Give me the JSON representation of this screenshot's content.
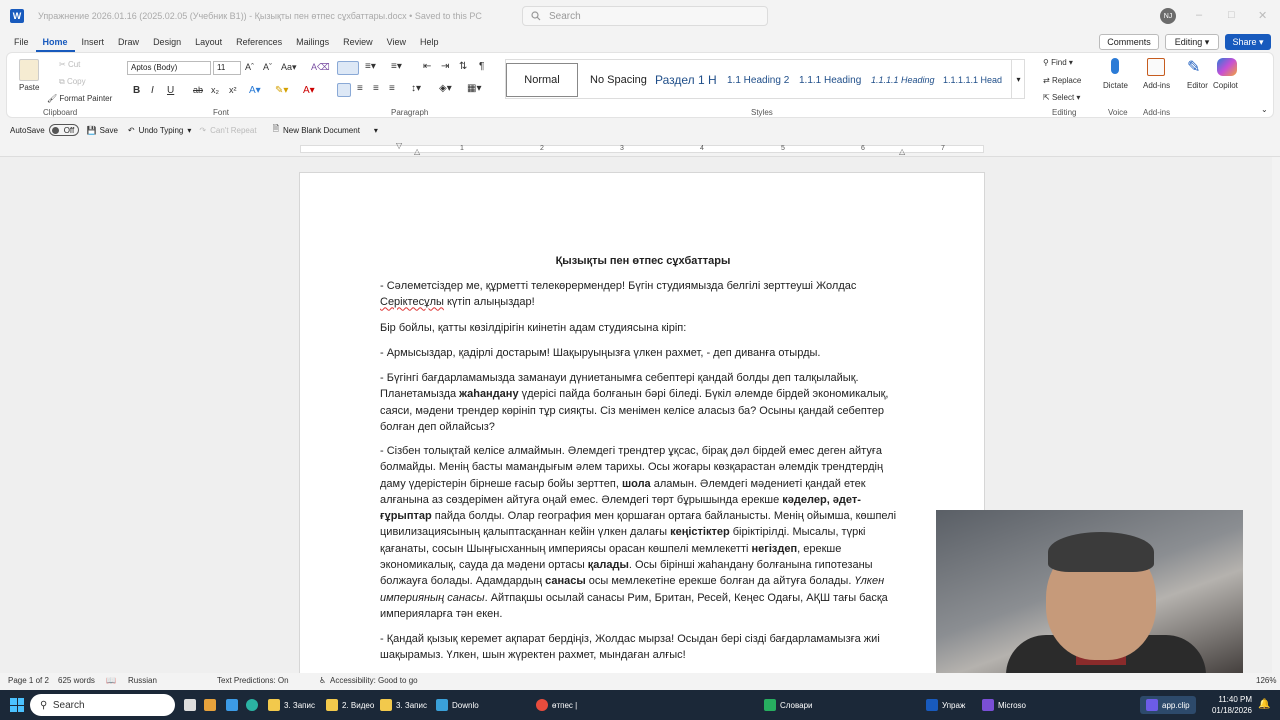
{
  "titlebar": {
    "app_icon": "W",
    "doc_title": "Упражнение 2026.01.16 (2025.02.05 (Учебник В1)) - Қызықты пен өтпес сұхбаттары.docx  •  Saved to this PC",
    "search_placeholder": "Search",
    "user_initials": "NJ"
  },
  "menu": {
    "items": [
      "File",
      "Home",
      "Insert",
      "Draw",
      "Design",
      "Layout",
      "References",
      "Mailings",
      "Review",
      "View",
      "Help"
    ],
    "active": "Home",
    "comments_label": "Comments",
    "editing_label": "Editing",
    "share_label": "Share"
  },
  "ribbon": {
    "clipboard": {
      "paste": "Paste",
      "cut": "Cut",
      "copy": "Copy",
      "format_painter": "Format Painter",
      "label": "Clipboard"
    },
    "font": {
      "name": "Aptos (Body)",
      "size": "11",
      "label": "Font"
    },
    "paragraph": {
      "label": "Paragraph"
    },
    "styles": {
      "items": [
        "Normal",
        "No Spacing",
        "Раздел 1 Н",
        "1.1  Heading 2",
        "1.1.1  Heading",
        "1.1.1.1  Heading",
        "1.1.1.1.1  Head"
      ],
      "label": "Styles"
    },
    "editing": {
      "find": "Find",
      "replace": "Replace",
      "select": "Select",
      "label": "Editing"
    },
    "voice": {
      "dictate": "Dictate",
      "label": "Voice"
    },
    "addins": {
      "addins": "Add-ins",
      "label": "Add-ins"
    },
    "editor": "Editor",
    "copilot": "Copilot"
  },
  "qat": {
    "autosave": "AutoSave",
    "autosave_state": "Off",
    "save": "Save",
    "undo": "Undo Typing",
    "redo": "Can't Repeat",
    "new_doc": "New Blank Document"
  },
  "ruler": {
    "numbers": [
      "1",
      "2",
      "3",
      "4",
      "5",
      "6",
      "7"
    ]
  },
  "document": {
    "heading": "Қызықты пен өтпес сұхбаттары",
    "p1": "- Сәлеметсіздер ме, құрметті телекөрермендер! Бүгін студиямызда белгілі зерттеуші Жолдас ",
    "p1_spell": "Серіктесұлы",
    "p1_end": " күтіп алыңыздар!",
    "p2": "Бір бойлы, қатты көзілдірігін киінетін адам студиясына кіріп:",
    "p3": "- Армысыздар, қадірлі достарым! Шақыруыңызға үлкен рахмет, - деп диванға отырды.",
    "p4a": "- Бүгінгі бағдарламамызда заманауи дүниетанымға себептері қандай болды деп талқылайық. Планетамызда ",
    "p4b": "жаһандану",
    "p4c": " үдерісі пайда болғанын бәрі біледі. Бүкіл әлемде бірдей экономикалық, саяси, мәдени трендер көрініп тұр сияқты. Сіз менімен келісе аласыз ба? Осыны қандай себептер болған деп ойлайсыз?",
    "p5a": "- Сізбен толықтай келісе алмаймын. Әлемдегі трендтер ұқсас, бірақ дәл бірдей емес деген айтуға болмайды. Менің басты мамандығым әлем тарихы. Осы жоғары көзқарастан әлемдік трендтердің даму үдерістерін бірнеше ғасыр бойы зерттеп, ",
    "p5b": "шола",
    "p5c": " аламын. Әлемдегі мәдениеті қандай етек алғанына аз сөздерімен айтуға оңай емес. Әлемдегі төрт бұрышында ерекше ",
    "p5d": "кәделер, әдет-ғұрыптар",
    "p5e": " пайда болды. Олар география мен қоршаған ортаға байланысты. Менің ойымша, көшпелі цивилизациясының қалыптасқаннан кейін үлкен далағы ",
    "p5f": "кеңістіктер",
    "p5g": " біріктірілді. Мысалы, түркі қағанаты, сосын Шыңғысханның империясы орасан көшпелі мемлекетті ",
    "p5h": "негіздеп",
    "p5i": ", ерекше экономикалық, сауда да мәдени ортасы ",
    "p5j": "қалады",
    "p5k": ". Осы бірінші жаһандану болғанына гипотезаны болжауға болады. Адамдардың ",
    "p5l": "санасы",
    "p5m": " осы мемлекетіне ерекше болған да айтуға болады. ",
    "p5n": "Үлкен империяның санасы",
    "p5o": ". Айтпақшы осылай санасы Рим, Британ, Ресей, Кеңес Одағы, АҚШ тағы басқа империяларға тән екен.",
    "p6": "- Қандай қызық керемет ақпарат бердіңіз, Жолдас мырза!  Осыдан бері сізді бағдарламамызға жиі шақырамыз. Үлкен, шын жүректен рахмет, мындаған алғыс!"
  },
  "statusbar": {
    "page": "Page 1 of 2",
    "words": "625 words",
    "language": "Russian",
    "predictions": "Text Predictions: On",
    "accessibility": "Accessibility: Good to go",
    "zoom": "126%"
  },
  "taskbar": {
    "search": "Search",
    "items": [
      "3. Запис",
      "2. Видео",
      "3. Запис",
      "Downlo",
      "өтпес |",
      "Словари",
      "Упраж",
      "Microso",
      "app.clip"
    ],
    "time": "11:40 PM",
    "date": "01/18/2026"
  },
  "colors": {
    "accent": "#185abd",
    "taskbar": "#1b2838"
  }
}
